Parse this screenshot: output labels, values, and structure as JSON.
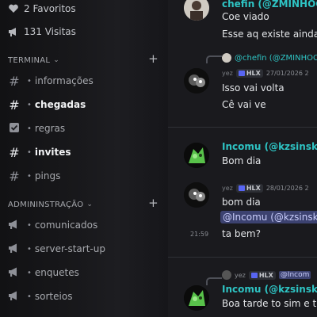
{
  "sidebar": {
    "stats": [
      {
        "icon": "heart-icon",
        "label": "2 Favoritos"
      },
      {
        "icon": "megaphone-icon",
        "label": "131 Visitas"
      }
    ],
    "categories": [
      {
        "name": "TERMINAL",
        "channels": [
          {
            "icon": "hashtag-icon",
            "label": "informações",
            "bold": false
          },
          {
            "icon": "hashtag-icon",
            "label": "chegadas",
            "bold": true
          },
          {
            "icon": "rules-icon",
            "label": "regras",
            "bold": false
          },
          {
            "icon": "hashtag-icon",
            "label": "invites",
            "bold": true
          },
          {
            "icon": "hashtag-icon",
            "label": "pings",
            "bold": false
          }
        ]
      },
      {
        "name": "ADMININSTRAÇÃO",
        "channels": [
          {
            "icon": "megaphone-icon",
            "label": "comunicados",
            "bold": false
          },
          {
            "icon": "megaphone-icon",
            "label": "server-start-up",
            "bold": false
          },
          {
            "icon": "megaphone-icon",
            "label": "enquetes",
            "bold": false
          },
          {
            "icon": "megaphone-icon",
            "label": "sorteios",
            "bold": false
          }
        ]
      }
    ]
  },
  "chat": {
    "accent": "#2ec4c4",
    "top": {
      "author": "chefin (@ZMINHOCA",
      "lines": [
        "Coe viado",
        "Esse aq existe ainda"
      ]
    },
    "reply1": {
      "author": "@chefin (@ZMINHOCA"
    },
    "msg2": {
      "name": "yez",
      "tag": "HLX",
      "date": "27/01/2026 2",
      "lines": [
        "Isso vai volta",
        "Cê vai ve"
      ]
    },
    "msg3": {
      "author": "Incomu (@kzsinsk)",
      "line": "Bom dia"
    },
    "msg4": {
      "name": "yez",
      "tag": "HLX",
      "date": "28/01/2026 2",
      "line1": "bom dia",
      "mention": "@Incomu (@kzsinsk)",
      "time": "21:59",
      "line2": "ta bem?"
    },
    "reply2": {
      "name": "yez",
      "tag": "HLX",
      "mention": "@Incom"
    },
    "msg5": {
      "author": "Incomu (@kzsinsk)",
      "line": "Boa tarde to sim e tu"
    }
  }
}
